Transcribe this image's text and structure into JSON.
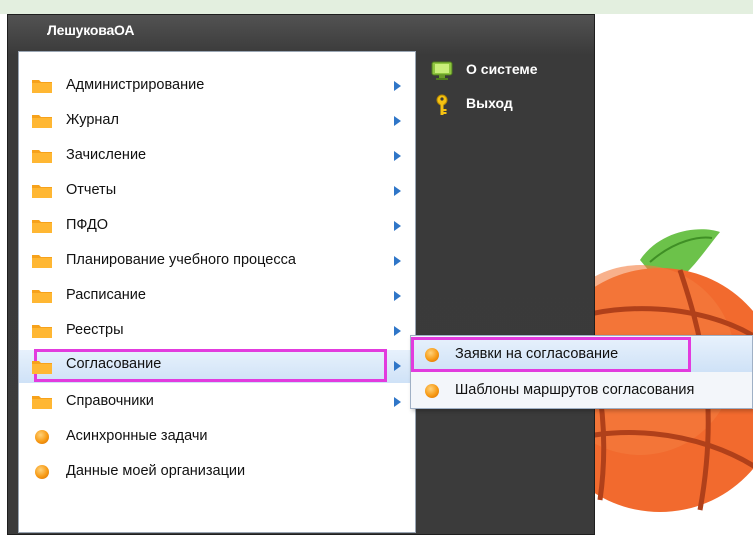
{
  "user": {
    "name": "ЛешуковаОА"
  },
  "menu": {
    "items": [
      {
        "label": "Администрирование",
        "icon": "folder-icon",
        "submenu": true
      },
      {
        "label": "Журнал",
        "icon": "folder-icon",
        "submenu": true
      },
      {
        "label": "Зачисление",
        "icon": "folder-icon",
        "submenu": true
      },
      {
        "label": "Отчеты",
        "icon": "folder-icon",
        "submenu": true
      },
      {
        "label": "ПФДО",
        "icon": "folder-icon",
        "submenu": true
      },
      {
        "label": "Планирование учебного процесса",
        "icon": "folder-icon",
        "submenu": true
      },
      {
        "label": "Расписание",
        "icon": "folder-icon",
        "submenu": true
      },
      {
        "label": "Реестры",
        "icon": "folder-icon",
        "submenu": true
      },
      {
        "label": "Согласование",
        "icon": "folder-icon",
        "submenu": true,
        "active": true
      },
      {
        "label": "Справочники",
        "icon": "folder-icon",
        "submenu": true
      },
      {
        "label": "Асинхронные задачи",
        "icon": "orb-icon",
        "submenu": false
      },
      {
        "label": "Данные моей организации",
        "icon": "orb-icon",
        "submenu": false
      }
    ],
    "right": [
      {
        "label": "О системе",
        "icon": "monitor-icon"
      },
      {
        "label": "Выход",
        "icon": "key-icon"
      }
    ]
  },
  "submenu": {
    "items": [
      {
        "label": "Заявки на согласование",
        "icon": "orb-icon",
        "active": true
      },
      {
        "label": "Шаблоны маршрутов согласования",
        "icon": "orb-icon"
      }
    ]
  },
  "colors": {
    "highlight_frame": "#e23bde",
    "menu_background": "#3b3b3b",
    "submenu_arrow": "#2f76c8",
    "folder": "#f7a21b"
  }
}
